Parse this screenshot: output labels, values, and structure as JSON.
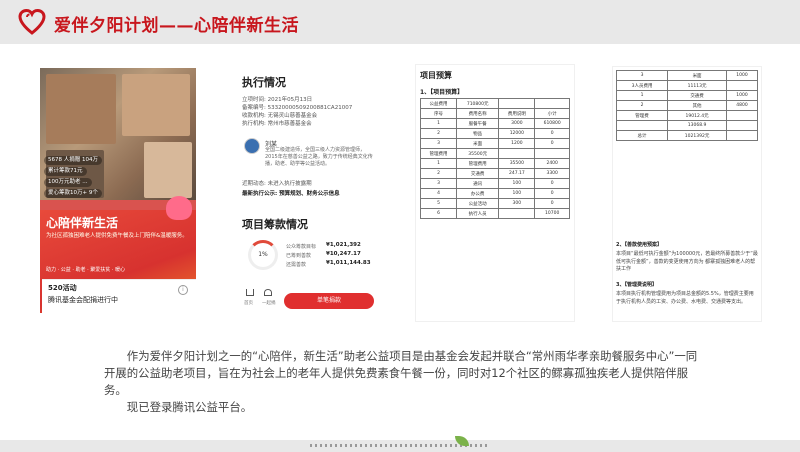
{
  "header": {
    "title": "爱伴夕阳计划——心陪伴新生活",
    "accent": "#c8161d"
  },
  "panel1": {
    "stats": [
      "5678 人捐赠 104万",
      "累计筹款71元",
      "100万元助老 ...",
      "爱心筹款10万+ 9个"
    ],
    "title": "心陪伴新生活",
    "desc": "为社区孤独困难老人提供免费午餐及上门陪伴&温暖服务。",
    "tags": "助力 · 公益 · 助老 · 聚爱扶贫 · 暖心",
    "bottom_line1": "520活动",
    "bottom_line2": "腾讯基金会配捐进行中"
  },
  "panel2": {
    "title": "执行情况",
    "rows": [
      "立项时间: 2021年05月13日",
      "备案编号: 53320000509200881CA21007",
      "收款机构: 无锡灵山慈善基金会",
      "执行机构: 常州市慈善基金会"
    ],
    "person_name": "刘某",
    "person_bio": "全国二级建造师，全国三级人力资源管理师，2015年在慈善公益之路，致力于传统经典文化传播，助老、助学等公益活动。",
    "progress_note": "近期动态: 未进入执行披露期",
    "disclosure": "最新执行公示: 预算规划、财务公示信息",
    "fund_title": "项目筹款情况",
    "fund_pct": "1%",
    "fund_stats": [
      {
        "label": "公众筹款目标",
        "value": "¥1,021,392"
      },
      {
        "label": "已筹到善款",
        "value": "¥10,247.17"
      },
      {
        "label": "还需善款",
        "value": "¥1,011,144.83"
      }
    ],
    "nav_home": "首页",
    "nav_team": "一起捐",
    "donate_label": "单笔捐款"
  },
  "panel3": {
    "title": "项目预算",
    "sub": "1、【项目预算】",
    "rows": [
      [
        "公益费用",
        "710800元",
        "",
        ""
      ],
      [
        "序号",
        "费用名称",
        "费用说明",
        "小计"
      ],
      [
        "1",
        "服餐午餐",
        "3000",
        "610800"
      ],
      [
        "2",
        "物品",
        "12000",
        "0"
      ],
      [
        "3",
        "米面",
        "1200",
        "0"
      ],
      [
        "管理费用",
        "35500元",
        "",
        ""
      ],
      [
        "1",
        "管理费用",
        "35500",
        "2400"
      ],
      [
        "2",
        "交通费",
        "247.17",
        "3300"
      ],
      [
        "3",
        "通讯",
        "100",
        "0"
      ],
      [
        "4",
        "办公费",
        "100",
        "0"
      ],
      [
        "5",
        "公益活动",
        "300",
        "0"
      ],
      [
        "6",
        "执行人员",
        "",
        "10700"
      ]
    ]
  },
  "panel4": {
    "rows": [
      [
        "3",
        "米面",
        "1000"
      ],
      [
        "3人员费用",
        "11113元",
        ""
      ],
      [
        "1",
        "交通费",
        "1000"
      ],
      [
        "2",
        "其他",
        "4800"
      ],
      [
        "管理费",
        "19012.4元",
        ""
      ],
      [
        "",
        "13068.9",
        ""
      ],
      [
        "总计",
        "1021392元",
        ""
      ]
    ],
    "note2_title": "2、【善款使用预案】",
    "note2": "本项目“最低可执行金额”为100000元，若最终所募善款少于“最低可执行金额”，善款的变更使用方向为 都寨孤独困难老人的帮扶工作",
    "note3_title": "3、【管理费说明】",
    "note3": "本项目执行机构管理费用为项目总金额的5.5%，管理费主要用于执行机构人员的工资、办公费、水电费、交通费等支出。"
  },
  "body": {
    "para1": "作为爱伴夕阳计划之一的“心陪伴，新生活”助老公益项目是由基金会发起并联合“常州雨华孝亲助餐服务中心”一同开展的公益助老项目，旨在为社会上的老年人提供免费素食午餐一份，同时对12个社区的鳏寡孤独疾老人提供陪伴服务。",
    "para2": "现已登录腾讯公益平台。"
  }
}
